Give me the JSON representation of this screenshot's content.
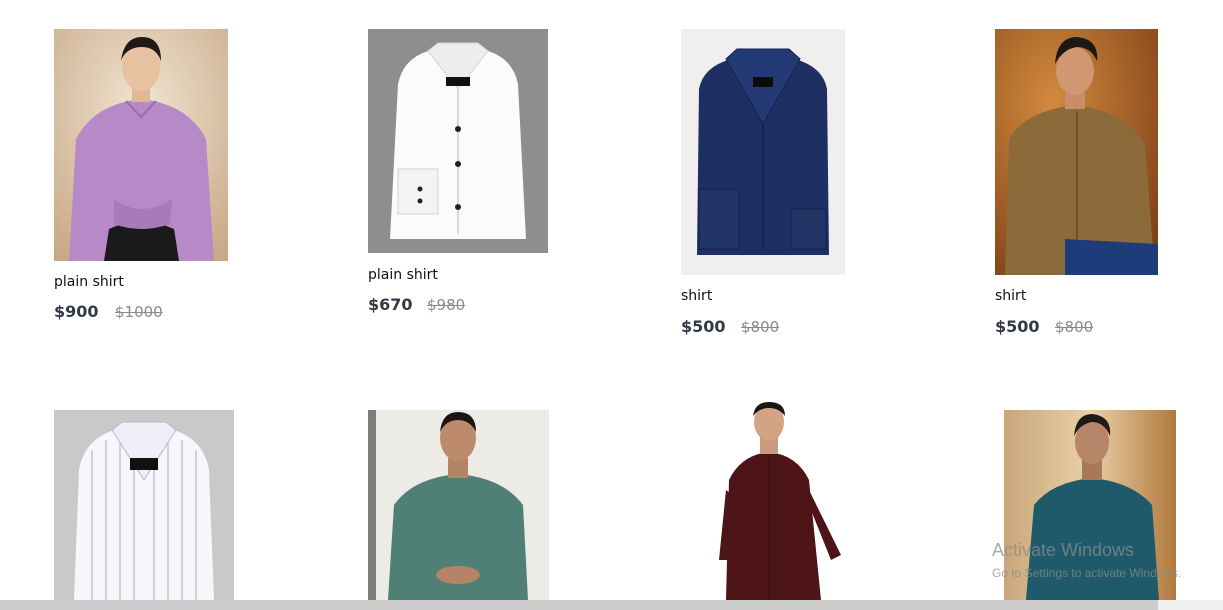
{
  "products": [
    {
      "name": "plain shirt",
      "price": "$900",
      "old_price": "$1000"
    },
    {
      "name": "plain shirt",
      "price": "$670",
      "old_price": "$980"
    },
    {
      "name": "shirt",
      "price": "$500",
      "old_price": "$800"
    },
    {
      "name": "shirt",
      "price": "$500",
      "old_price": "$800"
    }
  ],
  "watermark": {
    "title": "Activate Windows",
    "subtitle": "Go to Settings to activate Windows."
  }
}
